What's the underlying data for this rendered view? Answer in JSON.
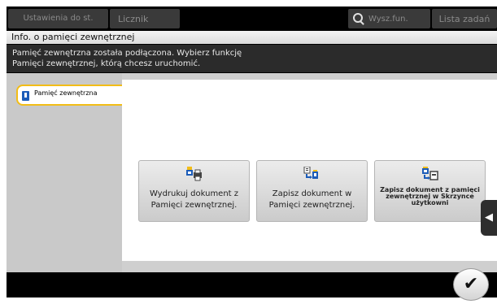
{
  "header": {
    "accessibility_label": "Ustawienia do st.",
    "counter_label": "Licznik",
    "search_label": "Wysz.fun.",
    "job_list_label": "Lista zadań"
  },
  "title": "Info. o pamięci zewnętrznej",
  "message": {
    "line1": "Pamięć zewnętrzna została podłączona. Wybierz funkcję",
    "line2": "Pamięci zewnętrznej, którą chcesz uruchomić."
  },
  "sidebar": {
    "tab_label": "Pamięć zewnętrzna"
  },
  "functions": [
    {
      "label": "Wydrukuj dokument z Pamięci zewnętrznej.",
      "icon": "print-from-memory-icon"
    },
    {
      "label": "Zapisz dokument w Pamięci zewnętrznej.",
      "icon": "save-to-memory-icon"
    },
    {
      "label": "Zapisz dokument z pamięci zewnętrznej w Skrzynce użytkowni",
      "icon": "save-to-box-icon"
    }
  ],
  "colors": {
    "accent": "#f2bd17",
    "usb_icon": "#1c5cb8"
  },
  "ok_symbol": "✔",
  "back_symbol": "◀"
}
